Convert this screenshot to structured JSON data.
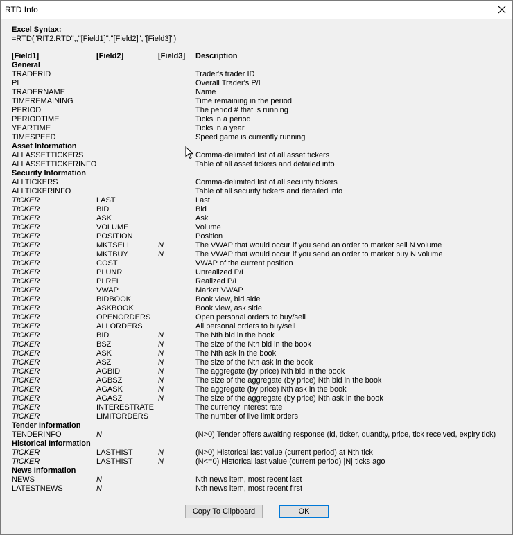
{
  "window": {
    "title": "RTD Info"
  },
  "syntax": {
    "label": "Excel Syntax:",
    "formula": "=RTD(\"RIT2.RTD\",,\"[Field1]\",\"[Field2]\",\"[Field3]\")"
  },
  "table": {
    "headers": [
      "[Field1]",
      "[Field2]",
      "[Field3]",
      "Description"
    ],
    "rows": [
      {
        "type": "section",
        "f1": "General"
      },
      {
        "f1": "TRADERID",
        "f2": "",
        "f3": "",
        "desc": "Trader's trader ID"
      },
      {
        "f1": "PL",
        "f2": "",
        "f3": "",
        "desc": "Overall Trader's P/L"
      },
      {
        "f1": "TRADERNAME",
        "f2": "",
        "f3": "",
        "desc": "Name"
      },
      {
        "f1": "TIMEREMAINING",
        "f2": "",
        "f3": "",
        "desc": "Time remaining in the period"
      },
      {
        "f1": "PERIOD",
        "f2": "",
        "f3": "",
        "desc": "The period # that is running"
      },
      {
        "f1": "PERIODTIME",
        "f2": "",
        "f3": "",
        "desc": "Ticks in a period"
      },
      {
        "f1": "YEARTIME",
        "f2": "",
        "f3": "",
        "desc": "Ticks in a year"
      },
      {
        "f1": "TIMESPEED",
        "f2": "",
        "f3": "",
        "desc": "Speed game is currently running"
      },
      {
        "type": "section",
        "f1": "Asset Information"
      },
      {
        "f1": "ALLASSETTICKERS",
        "f2": "",
        "f3": "",
        "desc": "Comma-delimited list of all asset tickers"
      },
      {
        "f1": "ALLASSETTICKERINFO",
        "f2": "",
        "f3": "",
        "desc": "Table of all asset tickers and detailed info"
      },
      {
        "type": "section",
        "f1": "Security Information"
      },
      {
        "f1": "ALLTICKERS",
        "f2": "",
        "f3": "",
        "desc": "Comma-delimited list of all security tickers"
      },
      {
        "f1": "ALLTICKERINFO",
        "f2": "",
        "f3": "",
        "desc": "Table of all security tickers and detailed info"
      },
      {
        "f1": "TICKER",
        "f1i": true,
        "f2": "LAST",
        "f3": "",
        "desc": "Last"
      },
      {
        "f1": "TICKER",
        "f1i": true,
        "f2": "BID",
        "f3": "",
        "desc": "Bid"
      },
      {
        "f1": "TICKER",
        "f1i": true,
        "f2": "ASK",
        "f3": "",
        "desc": "Ask"
      },
      {
        "f1": "TICKER",
        "f1i": true,
        "f2": "VOLUME",
        "f3": "",
        "desc": "Volume"
      },
      {
        "f1": "TICKER",
        "f1i": true,
        "f2": "POSITION",
        "f3": "",
        "desc": "Position"
      },
      {
        "f1": "TICKER",
        "f1i": true,
        "f2": "MKTSELL",
        "f3": "N",
        "desc": "The VWAP that would occur if you send an order to market sell N volume"
      },
      {
        "f1": "TICKER",
        "f1i": true,
        "f2": "MKTBUY",
        "f3": "N",
        "desc": "The VWAP that would occur if you send an order to market buy N volume"
      },
      {
        "f1": "TICKER",
        "f1i": true,
        "f2": "COST",
        "f3": "",
        "desc": "VWAP of the current position"
      },
      {
        "f1": "TICKER",
        "f1i": true,
        "f2": "PLUNR",
        "f3": "",
        "desc": "Unrealized P/L"
      },
      {
        "f1": "TICKER",
        "f1i": true,
        "f2": "PLREL",
        "f3": "",
        "desc": "Realized P/L"
      },
      {
        "f1": "TICKER",
        "f1i": true,
        "f2": "VWAP",
        "f3": "",
        "desc": "Market VWAP"
      },
      {
        "f1": "TICKER",
        "f1i": true,
        "f2": "BIDBOOK",
        "f3": "",
        "desc": "Book view, bid side"
      },
      {
        "f1": "TICKER",
        "f1i": true,
        "f2": "ASKBOOK",
        "f3": "",
        "desc": "Book view, ask side"
      },
      {
        "f1": "TICKER",
        "f1i": true,
        "f2": "OPENORDERS",
        "f3": "",
        "desc": "Open personal orders to buy/sell"
      },
      {
        "f1": "TICKER",
        "f1i": true,
        "f2": "ALLORDERS",
        "f3": "",
        "desc": "All personal orders to buy/sell"
      },
      {
        "f1": "TICKER",
        "f1i": true,
        "f2": "BID",
        "f3": "N",
        "desc": "The Nth bid in the book"
      },
      {
        "f1": "TICKER",
        "f1i": true,
        "f2": "BSZ",
        "f3": "N",
        "desc": "The size of the Nth bid in the book"
      },
      {
        "f1": "TICKER",
        "f1i": true,
        "f2": "ASK",
        "f3": "N",
        "desc": "The Nth ask in the book"
      },
      {
        "f1": "TICKER",
        "f1i": true,
        "f2": "ASZ",
        "f3": "N",
        "desc": "The size of the Nth ask in the book"
      },
      {
        "f1": "TICKER",
        "f1i": true,
        "f2": "AGBID",
        "f3": "N",
        "desc": "The aggregate (by price) Nth bid in the book"
      },
      {
        "f1": "TICKER",
        "f1i": true,
        "f2": "AGBSZ",
        "f3": "N",
        "desc": "The size of the aggregate (by price) Nth bid in the book"
      },
      {
        "f1": "TICKER",
        "f1i": true,
        "f2": "AGASK",
        "f3": "N",
        "desc": "The aggregate (by price) Nth ask in the book"
      },
      {
        "f1": "TICKER",
        "f1i": true,
        "f2": "AGASZ",
        "f3": "N",
        "desc": "The size of the aggregate (by price) Nth ask in the book"
      },
      {
        "f1": "TICKER",
        "f1i": true,
        "f2": "INTERESTRATE",
        "f3": "",
        "desc": "The currency interest rate"
      },
      {
        "f1": "TICKER",
        "f1i": true,
        "f2": "LIMITORDERS",
        "f3": "",
        "desc": "The number of live limit orders"
      },
      {
        "type": "section",
        "f1": "Tender Information"
      },
      {
        "f1": "TENDERINFO",
        "f2": "N",
        "f2i": true,
        "f3": "",
        "desc": "(N>0) Tender offers awaiting response (id, ticker, quantity, price, tick received, expiry tick)"
      },
      {
        "type": "section",
        "f1": "Historical Information"
      },
      {
        "f1": "TICKER",
        "f1i": true,
        "f2": "LASTHIST",
        "f3": "N",
        "desc": "(N>0) Historical last value (current period) at Nth tick"
      },
      {
        "f1": "TICKER",
        "f1i": true,
        "f2": "LASTHIST",
        "f3": "N",
        "desc": "(N<=0) Historical last value (current period) |N| ticks ago"
      },
      {
        "type": "section",
        "f1": "News Information"
      },
      {
        "f1": "NEWS",
        "f2": "N",
        "f2i": true,
        "f3": "",
        "desc": "Nth news item, most recent last"
      },
      {
        "f1": "LATESTNEWS",
        "f2": "N",
        "f2i": true,
        "f3": "",
        "desc": "Nth news item, most recent first"
      }
    ]
  },
  "buttons": {
    "copy_label": "Copy To Clipboard",
    "ok_label": "OK"
  },
  "icons": {
    "close": "close-icon",
    "cursor": "mouse-pointer-icon"
  },
  "colors": {
    "ok_border": "#0078d7",
    "window_bg": "#f0f0f0"
  }
}
